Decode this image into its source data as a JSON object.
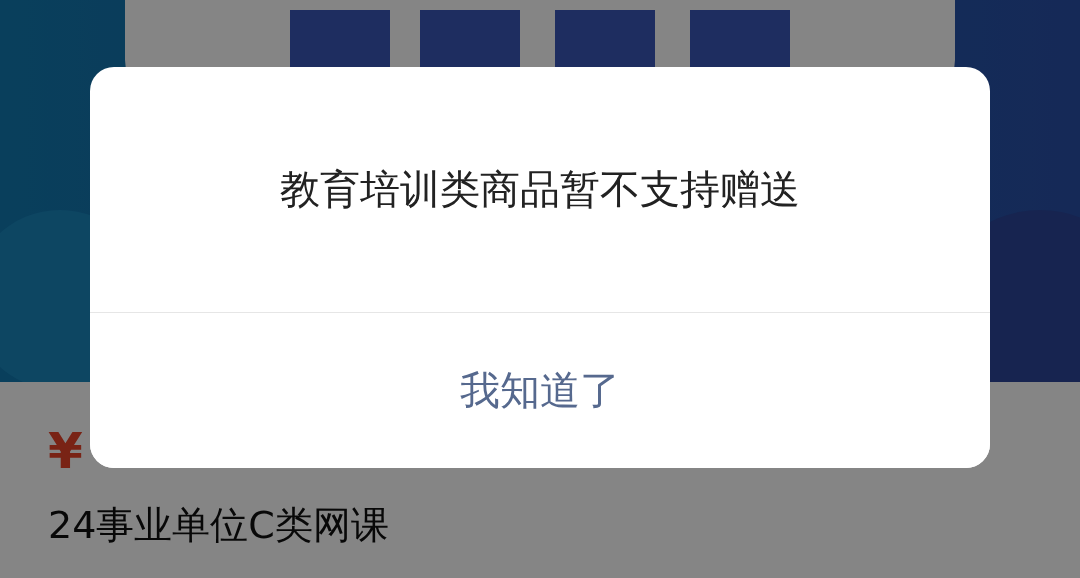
{
  "product": {
    "price": "¥",
    "title": "24事业单位C类网课"
  },
  "dialog": {
    "message": "教育培训类商品暂不支持赠送",
    "button": "我知道了"
  }
}
